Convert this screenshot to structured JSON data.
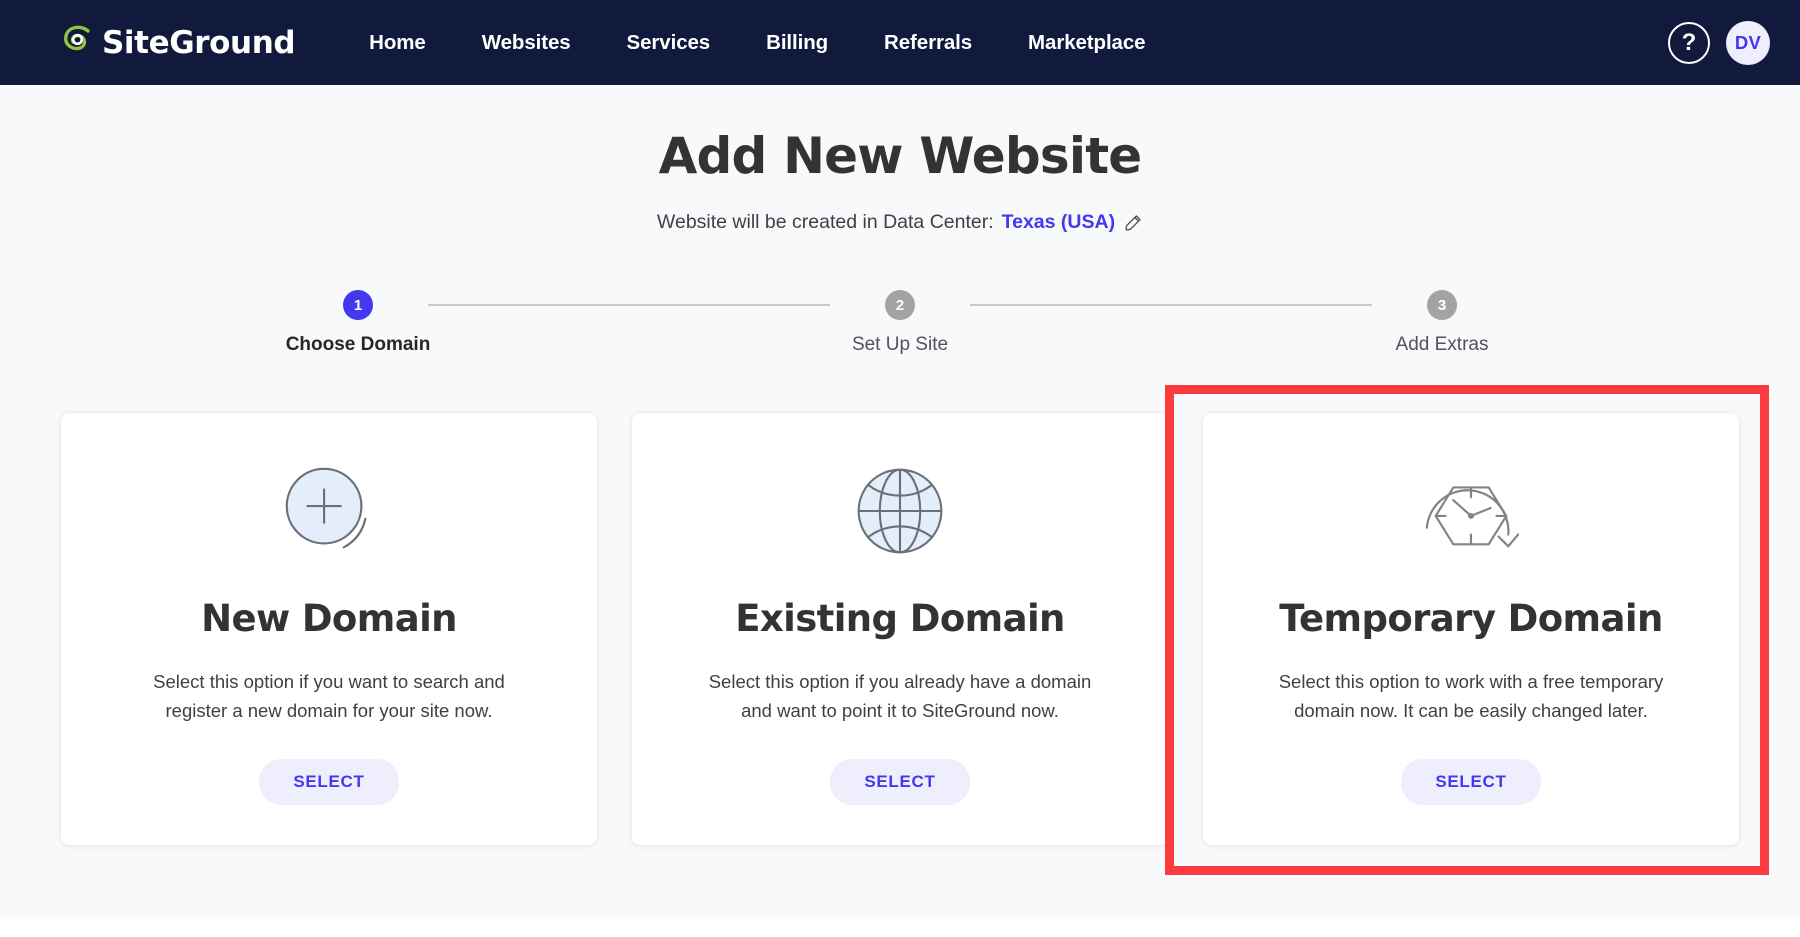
{
  "nav": {
    "brand": "SiteGround",
    "brand_icon": "siteground-logo-icon",
    "links": [
      {
        "label": "Home",
        "name": "nav-link-home"
      },
      {
        "label": "Websites",
        "name": "nav-link-websites"
      },
      {
        "label": "Services",
        "name": "nav-link-services"
      },
      {
        "label": "Billing",
        "name": "nav-link-billing"
      },
      {
        "label": "Referrals",
        "name": "nav-link-referrals"
      },
      {
        "label": "Marketplace",
        "name": "nav-link-marketplace"
      }
    ],
    "help_label": "?",
    "avatar_initials": "DV",
    "bg_color": "#111a3c"
  },
  "header": {
    "title": "Add New Website",
    "subtitle_prefix": "Website will be created in Data Center:",
    "data_center": "Texas (USA)",
    "edit_icon": "pencil-icon"
  },
  "stepper": {
    "steps": [
      {
        "number": "1",
        "label": "Choose Domain",
        "active": true
      },
      {
        "number": "2",
        "label": "Set Up Site",
        "active": false
      },
      {
        "number": "3",
        "label": "Add Extras",
        "active": false
      }
    ],
    "active_color": "#4338f0",
    "inactive_color": "#a3a3a3"
  },
  "cards": [
    {
      "icon": "plus-circle-icon",
      "title": "New Domain",
      "description": "Select this option if you want to search and register a new domain for your site now.",
      "button": "SELECT",
      "highlighted": false
    },
    {
      "icon": "globe-icon",
      "title": "Existing Domain",
      "description": "Select this option if you already have a domain and want to point it to SiteGround now.",
      "button": "SELECT",
      "highlighted": false
    },
    {
      "icon": "temporary-clock-icon",
      "title": "Temporary Domain",
      "description": "Select this option to work with a free temporary domain now. It can be easily changed later.",
      "button": "SELECT",
      "highlighted": true
    }
  ],
  "annotation": {
    "highlight_color": "#fb3b40"
  }
}
